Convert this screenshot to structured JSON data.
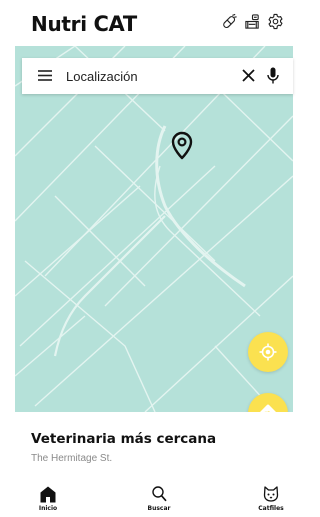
{
  "app": {
    "logo_text_1": "Nutri",
    "logo_text_2": "CAT"
  },
  "header": {
    "icons": [
      "pill-icon",
      "food-bowl-icon",
      "settings-gear-icon"
    ]
  },
  "search": {
    "placeholder": "Localización",
    "menu_icon": "hamburger-menu-icon",
    "clear_icon": "close-icon",
    "mic_icon": "microphone-icon"
  },
  "map": {
    "background_color": "#b5e1d9",
    "road_color": "#e3f4f0",
    "marker_icon": "location-pin-icon"
  },
  "fabs": {
    "color": "#fbe150",
    "locate_icon": "my-location-icon",
    "directions_icon": "directions-icon"
  },
  "info": {
    "title": "Veterinaria más cercana",
    "address": "The Hermitage St."
  },
  "nav": {
    "items": [
      {
        "label": "Inicio",
        "icon": "home-icon"
      },
      {
        "label": "Buscar",
        "icon": "search-icon"
      },
      {
        "label": "Catfiles",
        "icon": "cat-icon"
      }
    ]
  }
}
